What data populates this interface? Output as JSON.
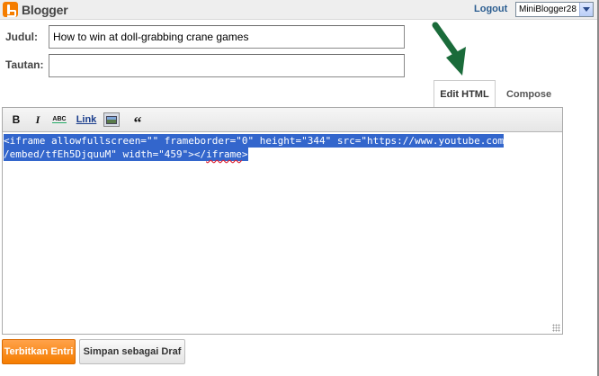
{
  "header": {
    "app_name": "Blogger",
    "logout_label": "Logout",
    "blog_selector": {
      "selected": "MiniBlogger28"
    }
  },
  "form": {
    "title_label": "Judul:",
    "title_value": "How to win at doll-grabbing crane games",
    "link_label": "Tautan:",
    "link_value": ""
  },
  "tabs": [
    {
      "label": "Edit HTML",
      "active": true
    },
    {
      "label": "Compose",
      "active": false
    }
  ],
  "toolbar": {
    "bold": "B",
    "italic": "I",
    "spellcheck": "ABC",
    "link": "Link",
    "image_icon": "image-icon",
    "quote": "“"
  },
  "editor": {
    "lines": [
      "<iframe allowfullscreen=\"\" frameborder=\"0\" height=\"344\" src=\"https://www.youtube.com",
      "/embed/tfEh5DjquuM\" width=\"459\"></",
      "iframe",
      ">"
    ]
  },
  "actions": {
    "publish_label": "Terbitkan Entri",
    "draft_label": "Simpan sebagai Draf"
  },
  "colors": {
    "accent_orange": "#f57d00",
    "selection_blue": "#3366cc",
    "annotation_arrow": "#1a6b3a"
  }
}
